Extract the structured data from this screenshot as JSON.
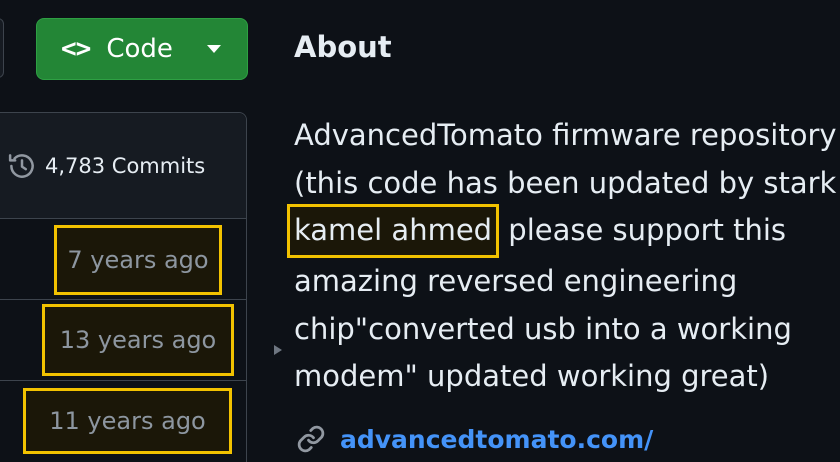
{
  "toolbar": {
    "code_button": {
      "icon": "code-icon",
      "icon_glyph": "<>",
      "label": "Code",
      "caret": "chevron-down-icon",
      "color": "#238636"
    }
  },
  "commits": {
    "icon": "history-icon",
    "count_label": "4,783 Commits"
  },
  "file_rows": [
    {
      "age": "7 years ago"
    },
    {
      "age": "13 years ago"
    },
    {
      "age": "11 years ago"
    }
  ],
  "about": {
    "title": "About",
    "description_lines": [
      "AdvancedTomato firmware repository",
      "(this code has been updated by stark",
      "",
      "amazing reversed engineering",
      "chip\"converted usb into a working",
      "modem\" updated working great)"
    ],
    "highlighted_name": "kamel ahmed",
    "line3_rest": "please support this",
    "website": {
      "icon": "link-icon",
      "text": "advancedtomato.com/",
      "color": "#4493f8"
    }
  },
  "highlight_color": "#f2c200"
}
